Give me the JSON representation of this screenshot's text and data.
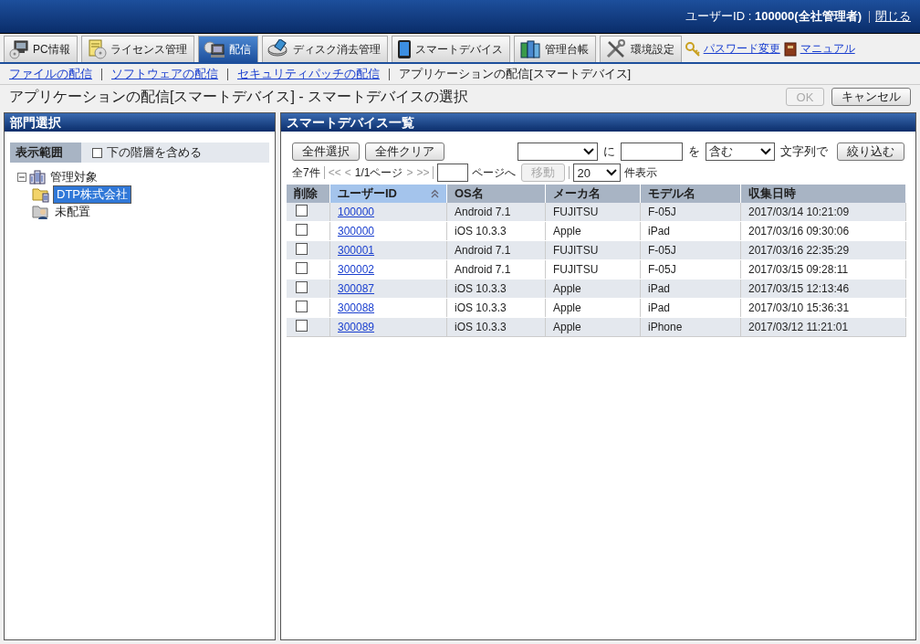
{
  "header": {
    "user_label": "ユーザーID : ",
    "user_value": "100000(全社管理者)",
    "close_link": "閉じる"
  },
  "tabs": [
    {
      "label": "PC情報",
      "kind": "pc",
      "selected": false
    },
    {
      "label": "ライセンス管理",
      "kind": "license",
      "selected": false
    },
    {
      "label": "配信",
      "kind": "delivery",
      "selected": true
    },
    {
      "label": "ディスク消去管理",
      "kind": "disk",
      "selected": false
    },
    {
      "label": "スマートデバイス",
      "kind": "phone",
      "selected": false
    },
    {
      "label": "管理台帳",
      "kind": "ledger",
      "selected": false
    },
    {
      "label": "環境設定",
      "kind": "tools",
      "selected": false
    }
  ],
  "tool_links": [
    {
      "label": "パスワード変更",
      "kind": "key"
    },
    {
      "label": "マニュアル",
      "kind": "book"
    }
  ],
  "breadcrumb": [
    {
      "label": "ファイルの配信",
      "kind": "link"
    },
    {
      "label": "ソフトウェアの配信",
      "kind": "link"
    },
    {
      "label": "セキュリティパッチの配信",
      "kind": "link"
    },
    {
      "label": "アプリケーションの配信[スマートデバイス]",
      "kind": "current"
    }
  ],
  "page_title": "アプリケーションの配信[スマートデバイス] - スマートデバイスの選択",
  "actions": [
    {
      "label": "OK",
      "disabled": true
    },
    {
      "label": "キャンセル",
      "disabled": false
    }
  ],
  "left_panel": {
    "title": "部門選択",
    "scope_label": "表示範囲",
    "include_sub": {
      "label": "下の階層を含める",
      "checked": false
    },
    "tree": [
      {
        "label": "管理対象",
        "kind": "building",
        "expanded": true,
        "selected": false,
        "children": [
          {
            "label": "DTP株式会社",
            "kind": "folder",
            "selected": true
          },
          {
            "label": "未配置",
            "kind": "person-folder",
            "selected": false
          }
        ]
      }
    ]
  },
  "right_panel": {
    "title": "スマートデバイス一覧",
    "buttons": [
      "全件選択",
      "全件クリア"
    ],
    "filter": {
      "connector_1": "に",
      "connector_2": "を",
      "match": "含む",
      "connector_3": "文字列で",
      "apply": "絞り込む"
    },
    "pager": {
      "total": "全7件",
      "first": "<<",
      "prev": "<",
      "page": "1/1ページ",
      "next": ">",
      "last": ">>",
      "page_suffix": "ページへ",
      "go": "移動",
      "go_disabled": true,
      "per_page": "20",
      "per_page_suffix": "件表示"
    },
    "table": {
      "columns": [
        {
          "label": "削除",
          "sorted": false
        },
        {
          "label": "ユーザーID",
          "sorted": true
        },
        {
          "label": "OS名",
          "sorted": false
        },
        {
          "label": "メーカ名",
          "sorted": false
        },
        {
          "label": "モデル名",
          "sorted": false
        },
        {
          "label": "収集日時",
          "sorted": false
        }
      ],
      "rows": [
        {
          "checked": false,
          "user_id": "100000",
          "os_name": "Android 7.1",
          "maker": "FUJITSU",
          "model": "F-05J",
          "collected_at": "2017/03/14 10:21:09"
        },
        {
          "checked": false,
          "user_id": "300000",
          "os_name": "iOS 10.3.3",
          "maker": "Apple",
          "model": "iPad",
          "collected_at": "2017/03/16 09:30:06"
        },
        {
          "checked": false,
          "user_id": "300001",
          "os_name": "Android 7.1",
          "maker": "FUJITSU",
          "model": "F-05J",
          "collected_at": "2017/03/16 22:35:29"
        },
        {
          "checked": false,
          "user_id": "300002",
          "os_name": "Android 7.1",
          "maker": "FUJITSU",
          "model": "F-05J",
          "collected_at": "2017/03/15 09:28:11"
        },
        {
          "checked": false,
          "user_id": "300087",
          "os_name": "iOS 10.3.3",
          "maker": "Apple",
          "model": "iPad",
          "collected_at": "2017/03/15 12:13:46"
        },
        {
          "checked": false,
          "user_id": "300088",
          "os_name": "iOS 10.3.3",
          "maker": "Apple",
          "model": "iPad",
          "collected_at": "2017/03/10 15:36:31"
        },
        {
          "checked": false,
          "user_id": "300089",
          "os_name": "iOS 10.3.3",
          "maker": "Apple",
          "model": "iPhone",
          "collected_at": "2017/03/12 11:21:01"
        }
      ]
    }
  }
}
